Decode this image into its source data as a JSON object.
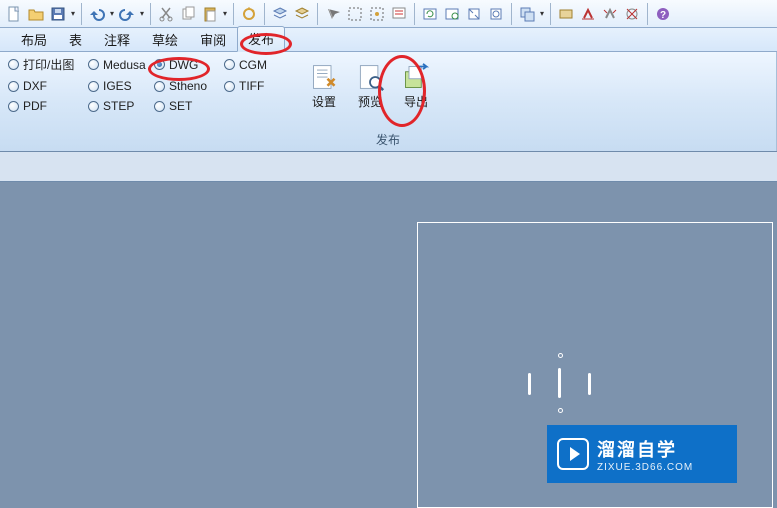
{
  "menu": {
    "tabs": [
      "布局",
      "表",
      "注释",
      "草绘",
      "审阅",
      "发布"
    ],
    "active_index": 5
  },
  "ribbon": {
    "group_label": "发布",
    "formats": [
      {
        "label": "打印/出图",
        "selected": false
      },
      {
        "label": "Medusa",
        "selected": false
      },
      {
        "label": "DWG",
        "selected": true
      },
      {
        "label": "CGM",
        "selected": false
      },
      {
        "label": "DXF",
        "selected": false
      },
      {
        "label": "IGES",
        "selected": false
      },
      {
        "label": "Stheno",
        "selected": false
      },
      {
        "label": "TIFF",
        "selected": false
      },
      {
        "label": "PDF",
        "selected": false
      },
      {
        "label": "STEP",
        "selected": false
      },
      {
        "label": "SET",
        "selected": false
      }
    ],
    "buttons": {
      "settings": "设置",
      "preview": "预览",
      "export": "导出"
    }
  },
  "watermark": {
    "line1": "溜溜自学",
    "line2": "ZIXUE.3D66.COM"
  },
  "toolbar_icons": [
    "new-file-icon",
    "open-icon",
    "save-icon",
    "save-dropdown",
    "sep",
    "undo-icon",
    "undo-dropdown",
    "redo-icon",
    "redo-dropdown",
    "sep",
    "cut-icon",
    "copy-icon",
    "paste-icon",
    "paste-dropdown",
    "sep",
    "regenerate-icon",
    "sep",
    "layers-icon",
    "layers2-icon",
    "sep",
    "find-icon",
    "select-box-icon",
    "select-chain-icon",
    "filter-icon",
    "sep",
    "refresh-view-icon",
    "repaint-icon",
    "fit-icon",
    "fit2-icon",
    "sep",
    "window-icon",
    "window-dropdown",
    "sep",
    "tool-a-icon",
    "tool-b-icon",
    "tool-c-icon",
    "tool-d-icon",
    "sep",
    "help-icon"
  ]
}
